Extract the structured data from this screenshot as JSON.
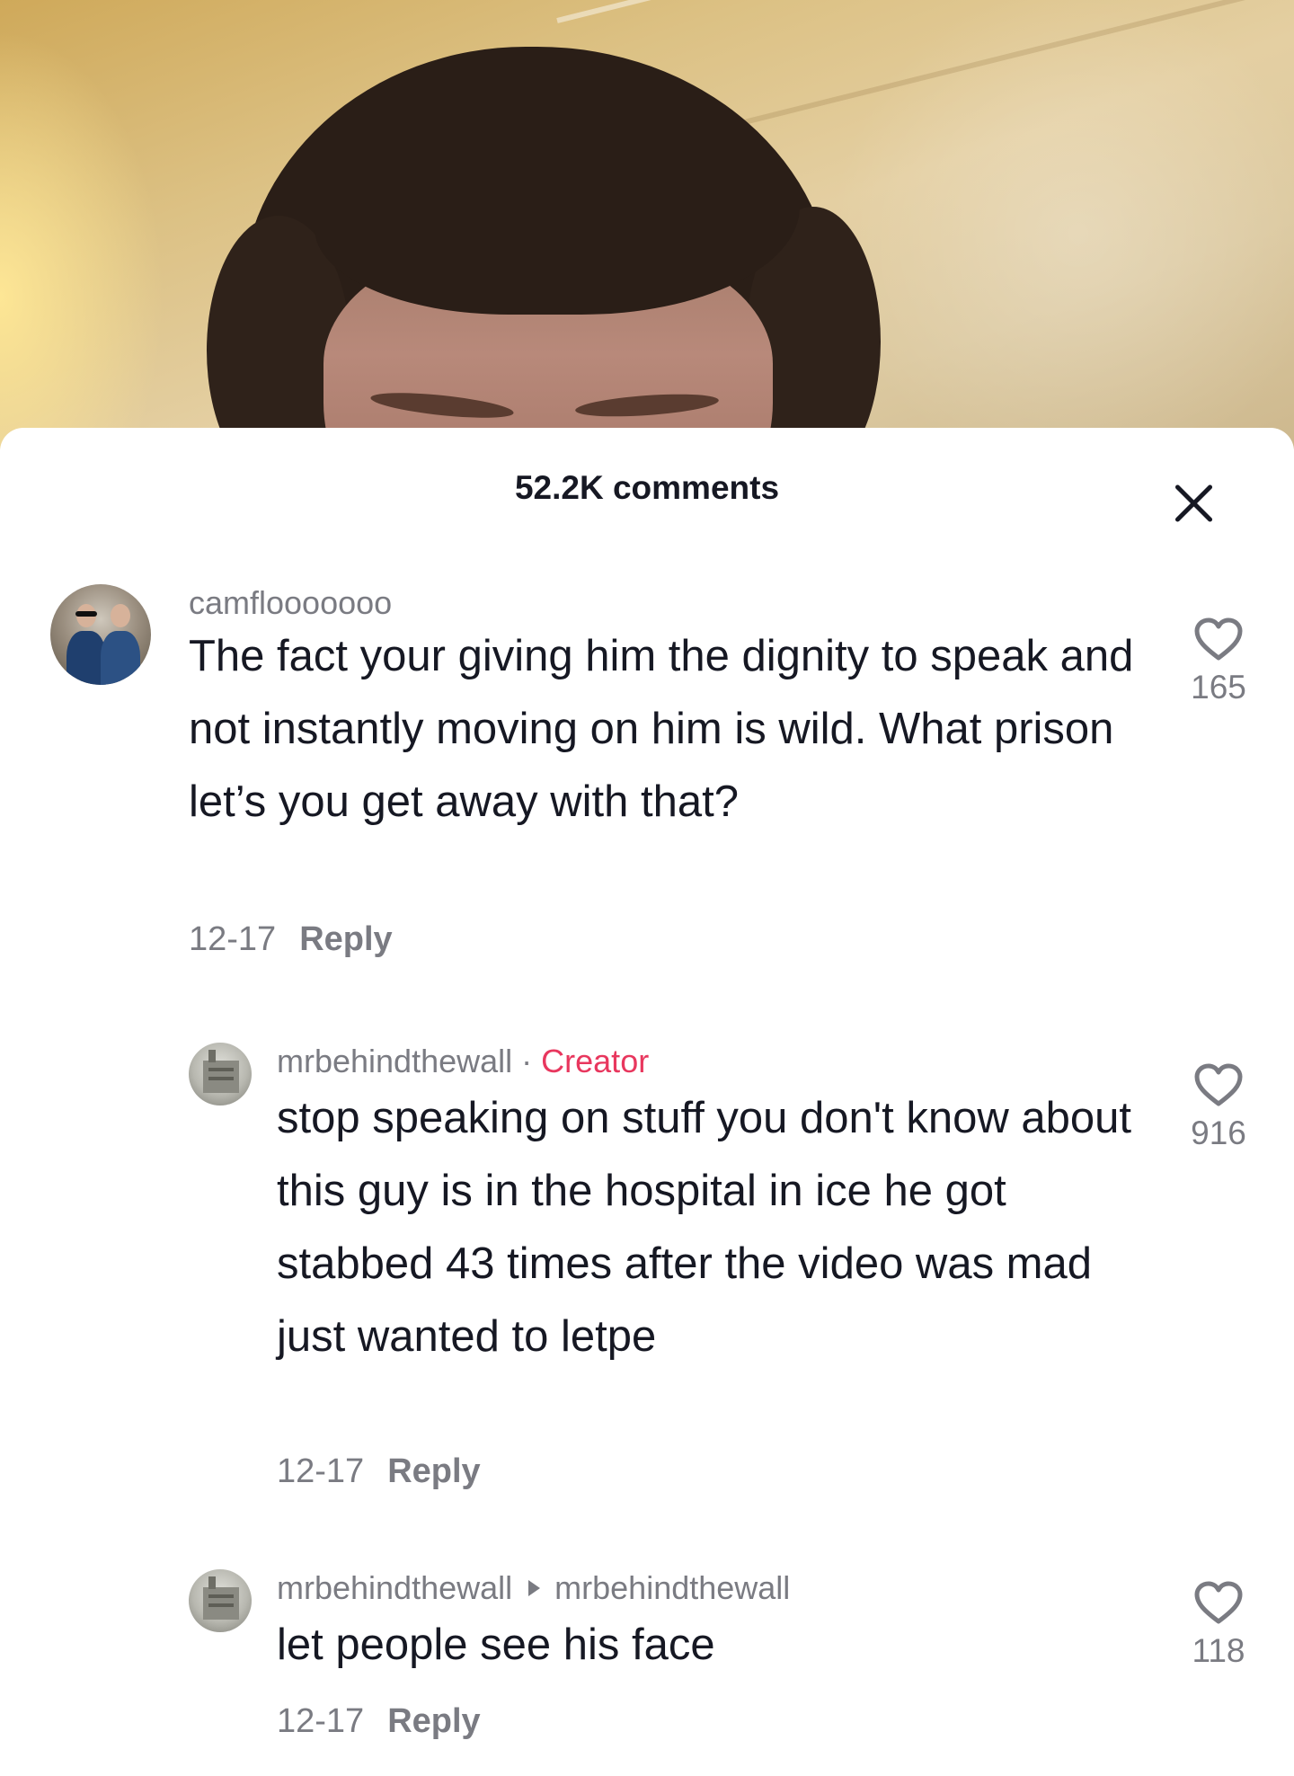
{
  "header": {
    "comment_count": "52.2K comments"
  },
  "comments": [
    {
      "username": "camflooooooo",
      "text": "The fact your giving him the dignity to speak and not instantly moving on him is wild. What prison let’s you get away with that?",
      "date": "12-17",
      "reply_label": "Reply",
      "likes": "165"
    },
    {
      "username": "mrbehindthewall",
      "separator": "·",
      "badge": "Creator",
      "text": "stop speaking on stuff you don't know about this guy is in the hospital in ice he got stabbed 43 times after the video was mad just wanted to letpe",
      "date": "12-17",
      "reply_label": "Reply",
      "likes": "916"
    },
    {
      "username": "mrbehindthewall",
      "reply_to": "mrbehindthewall",
      "text": "let people see his face",
      "date": "12-17",
      "reply_label": "Reply",
      "likes": "118"
    }
  ],
  "icons": {
    "close": "close-icon",
    "like": "heart-outline-icon"
  },
  "colors": {
    "text_primary": "#161823",
    "text_secondary": "#7a7b82",
    "creator_badge": "#e8375e"
  }
}
